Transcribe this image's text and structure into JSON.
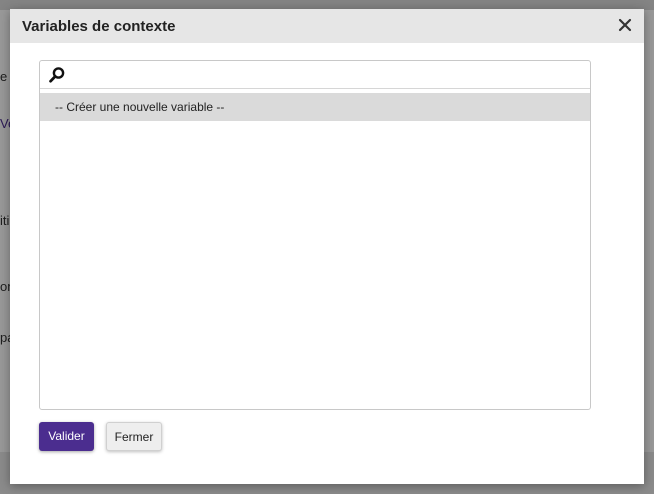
{
  "background": {
    "fragments": [
      "e v",
      "Ve",
      "iti",
      "on",
      "pa"
    ]
  },
  "dialog": {
    "title": "Variables de contexte",
    "close_icon": "close-icon",
    "search": {
      "icon": "search-icon",
      "value": "",
      "placeholder": ""
    },
    "options": [
      {
        "label": "-- Créer une nouvelle variable --",
        "selected": true
      }
    ],
    "buttons": {
      "validate_label": "Valider",
      "close_label": "Fermer"
    }
  },
  "colors": {
    "primary": "#4b2d8f",
    "header_bg": "#e6e6e6",
    "selected_option_bg": "#dadada"
  }
}
